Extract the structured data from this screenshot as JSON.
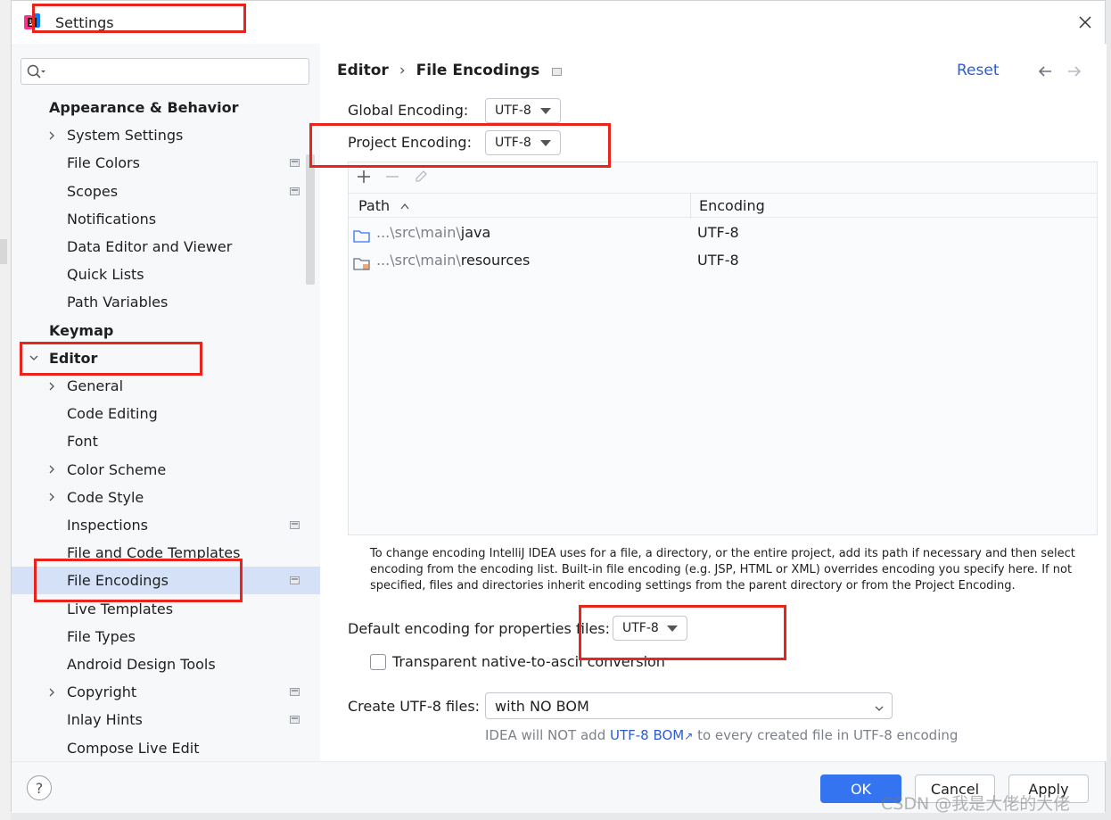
{
  "window": {
    "title": "Settings"
  },
  "search": {
    "placeholder": ""
  },
  "sidebar": {
    "items": [
      {
        "label": "Appearance & Behavior",
        "group": true
      },
      {
        "label": "System Settings",
        "expandable": true
      },
      {
        "label": "File Colors",
        "project": true
      },
      {
        "label": "Scopes",
        "project": true
      },
      {
        "label": "Notifications"
      },
      {
        "label": "Data Editor and Viewer"
      },
      {
        "label": "Quick Lists"
      },
      {
        "label": "Path Variables"
      },
      {
        "label": "Keymap",
        "group": true
      },
      {
        "label": "Editor",
        "group": true,
        "expanded": true
      },
      {
        "label": "General",
        "expandable": true
      },
      {
        "label": "Code Editing"
      },
      {
        "label": "Font"
      },
      {
        "label": "Color Scheme",
        "expandable": true
      },
      {
        "label": "Code Style",
        "expandable": true
      },
      {
        "label": "Inspections",
        "project": true
      },
      {
        "label": "File and Code Templates"
      },
      {
        "label": "File Encodings",
        "project": true,
        "selected": true
      },
      {
        "label": "Live Templates"
      },
      {
        "label": "File Types"
      },
      {
        "label": "Android Design Tools"
      },
      {
        "label": "Copyright",
        "expandable": true,
        "project": true
      },
      {
        "label": "Inlay Hints",
        "project": true
      },
      {
        "label": "Compose Live Edit"
      }
    ]
  },
  "header": {
    "breadcrumb_parent": "Editor",
    "breadcrumb_sep": "›",
    "breadcrumb_current": "File Encodings",
    "reset_label": "Reset"
  },
  "encoding": {
    "global_label": "Global Encoding:",
    "global_value": "UTF-8",
    "project_label": "Project Encoding:",
    "project_value": "UTF-8"
  },
  "table": {
    "columns": {
      "path": "Path",
      "encoding": "Encoding"
    },
    "rows": [
      {
        "path_prefix": "...\\src\\main\\",
        "path_name": "java",
        "encoding": "UTF-8",
        "icon": "folder-icon"
      },
      {
        "path_prefix": "...\\src\\main\\",
        "path_name": "resources",
        "encoding": "UTF-8",
        "icon": "resources-folder-icon"
      }
    ]
  },
  "help_text": "To change encoding IntelliJ IDEA uses for a file, a directory, or the entire project, add its path if necessary and then select encoding from the encoding list. Built-in file encoding (e.g. JSP, HTML or XML) overrides encoding you specify here. If not specified, files and directories inherit encoding settings from the parent directory or from the Project Encoding.",
  "properties": {
    "label": "Default encoding for properties files:",
    "value": "UTF-8",
    "transparent_label": "Transparent native-to-ascii conversion",
    "transparent_checked": false
  },
  "bom": {
    "label": "Create UTF-8 files:",
    "value": "with NO BOM",
    "hint_pre": "IDEA will NOT add ",
    "hint_link": "UTF-8 BOM",
    "hint_link_arrow": "↗",
    "hint_post": " to every created file in UTF-8 encoding"
  },
  "footer": {
    "help": "?",
    "ok": "OK",
    "cancel": "Cancel",
    "apply": "Apply"
  },
  "watermark": "CSDN @我是大佬的大佬",
  "colors": {
    "accent": "#3574f0",
    "link": "#2f5dcc",
    "selection": "#d5e1f7",
    "annotation": "#e8241c"
  }
}
